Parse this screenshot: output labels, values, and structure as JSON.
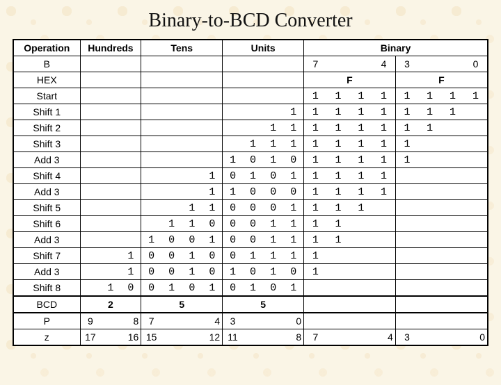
{
  "title": "Binary-to-BCD Converter",
  "headers": {
    "operation": "Operation",
    "hundreds": "Hundreds",
    "tens": "Tens",
    "units": "Units",
    "binary": "Binary"
  },
  "row_b": {
    "op": "B",
    "binary_left": "7",
    "binary_mid": "4",
    "binary_mid2": "3",
    "binary_right": "0"
  },
  "row_hex": {
    "op": "HEX",
    "val_left": "F",
    "val_right": "F"
  },
  "steps": [
    {
      "op": "Start",
      "h": [
        "",
        "",
        ""
      ],
      "t": [
        "",
        "",
        "",
        ""
      ],
      "u": [
        "",
        "",
        "",
        ""
      ],
      "bL": [
        "1",
        "1",
        "1",
        "1"
      ],
      "bR": [
        "1",
        "1",
        "1",
        "1"
      ]
    },
    {
      "op": "Shift 1",
      "h": [
        "",
        "",
        ""
      ],
      "t": [
        "",
        "",
        "",
        ""
      ],
      "u": [
        "",
        "",
        "",
        "1"
      ],
      "bL": [
        "1",
        "1",
        "1",
        "1"
      ],
      "bR": [
        "1",
        "1",
        "1",
        ""
      ]
    },
    {
      "op": "Shift 2",
      "h": [
        "",
        "",
        ""
      ],
      "t": [
        "",
        "",
        "",
        ""
      ],
      "u": [
        "",
        "",
        "1",
        "1"
      ],
      "bL": [
        "1",
        "1",
        "1",
        "1"
      ],
      "bR": [
        "1",
        "1",
        "",
        ""
      ]
    },
    {
      "op": "Shift 3",
      "h": [
        "",
        "",
        ""
      ],
      "t": [
        "",
        "",
        "",
        ""
      ],
      "u": [
        "",
        "1",
        "1",
        "1"
      ],
      "bL": [
        "1",
        "1",
        "1",
        "1"
      ],
      "bR": [
        "1",
        "",
        "",
        ""
      ]
    },
    {
      "op": "Add 3",
      "h": [
        "",
        "",
        ""
      ],
      "t": [
        "",
        "",
        "",
        ""
      ],
      "u": [
        "1",
        "0",
        "1",
        "0"
      ],
      "bL": [
        "1",
        "1",
        "1",
        "1"
      ],
      "bR": [
        "1",
        "",
        "",
        ""
      ]
    },
    {
      "op": "Shift 4",
      "h": [
        "",
        "",
        ""
      ],
      "t": [
        "",
        "",
        "",
        "1"
      ],
      "u": [
        "0",
        "1",
        "0",
        "1"
      ],
      "bL": [
        "1",
        "1",
        "1",
        "1"
      ],
      "bR": [
        "",
        "",
        "",
        ""
      ]
    },
    {
      "op": "Add 3",
      "h": [
        "",
        "",
        ""
      ],
      "t": [
        "",
        "",
        "",
        "1"
      ],
      "u": [
        "1",
        "0",
        "0",
        "0"
      ],
      "bL": [
        "1",
        "1",
        "1",
        "1"
      ],
      "bR": [
        "",
        "",
        "",
        ""
      ]
    },
    {
      "op": "Shift 5",
      "h": [
        "",
        "",
        ""
      ],
      "t": [
        "",
        "",
        "1",
        "1"
      ],
      "u": [
        "0",
        "0",
        "0",
        "1"
      ],
      "bL": [
        "1",
        "1",
        "1",
        ""
      ],
      "bR": [
        "",
        "",
        "",
        ""
      ]
    },
    {
      "op": "Shift 6",
      "h": [
        "",
        "",
        ""
      ],
      "t": [
        "",
        "1",
        "1",
        "0"
      ],
      "u": [
        "0",
        "0",
        "1",
        "1"
      ],
      "bL": [
        "1",
        "1",
        "",
        ""
      ],
      "bR": [
        "",
        "",
        "",
        ""
      ]
    },
    {
      "op": "Add 3",
      "h": [
        "",
        "",
        ""
      ],
      "t": [
        "1",
        "0",
        "0",
        "1"
      ],
      "u": [
        "0",
        "0",
        "1",
        "1"
      ],
      "bL": [
        "1",
        "1",
        "",
        ""
      ],
      "bR": [
        "",
        "",
        "",
        ""
      ]
    },
    {
      "op": "Shift 7",
      "h": [
        "",
        "",
        "1"
      ],
      "t": [
        "0",
        "0",
        "1",
        "0"
      ],
      "u": [
        "0",
        "1",
        "1",
        "1"
      ],
      "bL": [
        "1",
        "",
        "",
        ""
      ],
      "bR": [
        "",
        "",
        "",
        ""
      ]
    },
    {
      "op": "Add 3",
      "h": [
        "",
        "",
        "1"
      ],
      "t": [
        "0",
        "0",
        "1",
        "0"
      ],
      "u": [
        "1",
        "0",
        "1",
        "0"
      ],
      "bL": [
        "1",
        "",
        "",
        ""
      ],
      "bR": [
        "",
        "",
        "",
        ""
      ]
    },
    {
      "op": "Shift 8",
      "h": [
        "",
        "1",
        "0"
      ],
      "t": [
        "0",
        "1",
        "0",
        "1"
      ],
      "u": [
        "0",
        "1",
        "0",
        "1"
      ],
      "bL": [
        "",
        "",
        "",
        ""
      ],
      "bR": [
        "",
        "",
        "",
        ""
      ]
    }
  ],
  "row_bcd": {
    "op": "BCD",
    "h": "2",
    "t": "5",
    "u": "5"
  },
  "row_p": {
    "op": "P",
    "vals": [
      "9",
      "8",
      "7",
      "",
      "",
      "4",
      "3",
      "",
      "",
      "0",
      "",
      "",
      "",
      "",
      "",
      "",
      "",
      ""
    ]
  },
  "row_z": {
    "op": "z",
    "vals": [
      "17",
      "16",
      "15",
      "",
      "",
      "12",
      "11",
      "",
      "",
      "8",
      "7",
      "",
      "",
      "4",
      "3",
      "",
      "",
      "0"
    ]
  },
  "chart_data": {
    "type": "table",
    "title": "Binary-to-BCD Converter (shift-and-add-3 / double-dabble, input 0xFF = 255)",
    "columns": [
      "Operation",
      "Hundreds",
      "Tens",
      "Units",
      "Binary"
    ],
    "rows": [
      [
        "Start",
        "",
        "",
        "",
        "1111 1111"
      ],
      [
        "Shift 1",
        "",
        "",
        "1",
        "1111 111"
      ],
      [
        "Shift 2",
        "",
        "",
        "11",
        "1111 11"
      ],
      [
        "Shift 3",
        "",
        "",
        "111",
        "1111 1"
      ],
      [
        "Add 3",
        "",
        "",
        "1010",
        "1111 1"
      ],
      [
        "Shift 4",
        "",
        "1",
        "0101",
        "1111"
      ],
      [
        "Add 3",
        "",
        "1",
        "1000",
        "1111"
      ],
      [
        "Shift 5",
        "",
        "11",
        "0001",
        "111"
      ],
      [
        "Shift 6",
        "",
        "110",
        "0011",
        "11"
      ],
      [
        "Add 3",
        "",
        "1001",
        "0011",
        "11"
      ],
      [
        "Shift 7",
        "1",
        "0010",
        "0111",
        "1"
      ],
      [
        "Add 3",
        "1",
        "0010",
        "1010",
        "1"
      ],
      [
        "Shift 8",
        "10",
        "0101",
        "0101",
        ""
      ]
    ],
    "result_bcd": {
      "hundreds": 2,
      "tens": 5,
      "units": 5
    },
    "P_index": {
      "hundreds_msb": 9,
      "hundreds_lsb": 8,
      "tens_msb": 7,
      "tens_lsb": 4,
      "units_msb": 3,
      "units_lsb": 0
    },
    "z_index": {
      "17": 17,
      "16": 16,
      "15": 15,
      "12": 12,
      "11": 11,
      "8": 8,
      "7": 7,
      "4": 4,
      "3": 3,
      "0": 0
    }
  }
}
